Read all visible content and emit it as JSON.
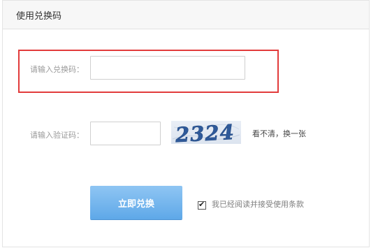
{
  "panel": {
    "title": "使用兑换码"
  },
  "redeem_code": {
    "label": "请输入兑换码：",
    "value": "",
    "placeholder": ""
  },
  "captcha": {
    "label": "请输入验证码：",
    "value": "",
    "placeholder": "",
    "image_text": "2324",
    "refresh_label": "看不清，换一张"
  },
  "submit": {
    "label": "立即兑换"
  },
  "agreement": {
    "checked": true,
    "label": "我已经阅读并接受使用条款"
  },
  "colors": {
    "highlight": "#e23b3b",
    "button": "#6fb2ec"
  }
}
